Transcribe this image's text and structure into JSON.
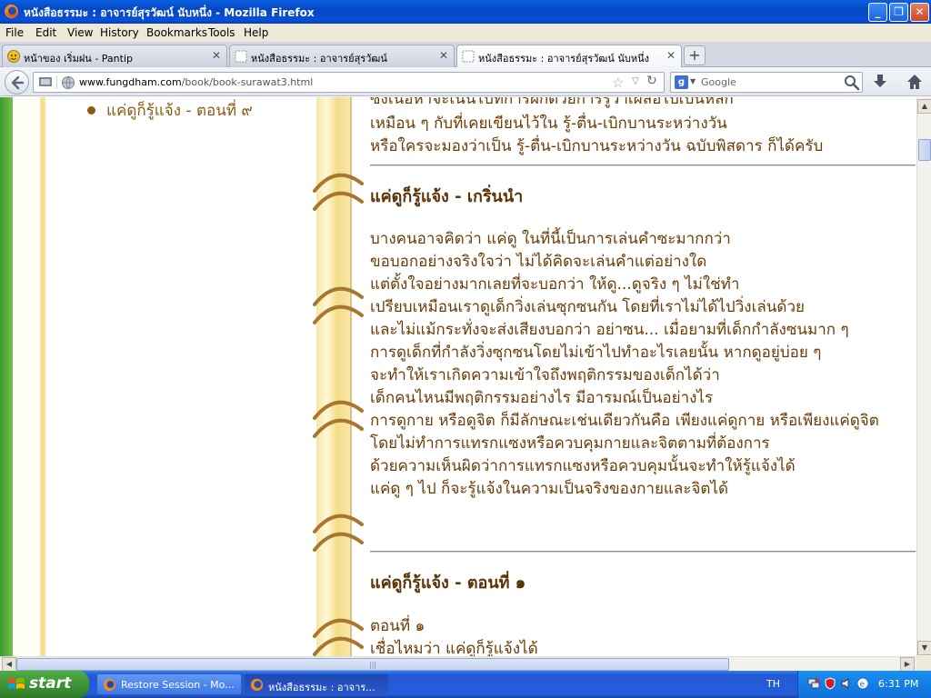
{
  "window": {
    "title": "หนังสือธรรมะ : อาจารย์สุรวัฒน์ นับหนึ่ง - Mozilla Firefox"
  },
  "menu": [
    "File",
    "Edit",
    "View",
    "History",
    "Bookmarks",
    "Tools",
    "Help"
  ],
  "tabs": [
    {
      "label": "หน้าของ เริ่มฝน - Pantip"
    },
    {
      "label": "หนังสือธรรมะ : อาจารย์สุรวัฒน์"
    },
    {
      "label": "หนังสือธรรมะ : อาจารย์สุรวัฒน์ นับหนึ่ง"
    }
  ],
  "nav": {
    "url_domain": "www.fungdham.com",
    "url_path": "/book/book-surawat3.html",
    "search_placeholder": "Google"
  },
  "page": {
    "sidebar_link": "แค่ดูก็รู้แจ้ง - ตอนที่ ๙",
    "top_lines": [
      "ซึ่งเนื้อหาจะเน้นไปที่การฝึกด้วยการรู้ว่าเผลอไปเป็นหลัก",
      "เหมือน ๆ กับที่เคยเขียนไว้ใน รู้-ตื่น-เบิกบานระหว่างวัน",
      "หรือใครจะมองว่าเป็น รู้-ตื่น-เบิกบานระหว่างวัน ฉบับพิสดาร ก็ได้ครับ"
    ],
    "section1_heading": "แค่ดูก็รู้แจ้ง - เกริ่นนำ",
    "section1_lines": [
      "บางคนอาจคิดว่า แค่ดู ในที่นี้เป็นการเล่นคำซะมากกว่า",
      "ขอบอกอย่างจริงใจว่า ไม่ได้คิดจะเล่นคำแต่อย่างใด",
      "แต่ตั้งใจอย่างมากเลยที่จะบอกว่า ให้ดู...ดูจริง ๆ ไม่ใช่ทำ",
      "เปรียบเหมือนเราดูเด็กวิ่งเล่นซุกซนกัน โดยที่เราไม่ได้ไปวิ่งเล่นด้วย",
      "และไม่แม้กระทั่งจะส่งเสียงบอกว่า อย่าซน... เมื่อยามที่เด็กกำลังซนมาก ๆ",
      "การดูเด็กที่กำลังวิ่งซุกซนโดยไม่เข้าไปทำอะไรเลยนั้น หากดูอยู่บ่อย ๆ",
      "จะทำให้เราเกิดความเข้าใจถึงพฤติกรรมของเด็กได้ว่า",
      "เด็กคนไหนมีพฤติกรรมอย่างไร มีอารมณ์เป็นอย่างไร",
      "การดูกาย หรือดูจิต ก็มีลักษณะเช่นเดียวกันคือ เพียงแค่ดูกาย หรือเพียงแค่ดูจิต",
      "โดยไม่ทำการแทรกแซงหรือควบคุมกายและจิตตามที่ต้องการ",
      "ด้วยความเห็นผิดว่าการแทรกแซงหรือควบคุมนั้นจะทำให้รู้แจ้งได้",
      "แค่ดู ๆ ไป ก็จะรู้แจ้งในความเป็นจริงของกายและจิตได้"
    ],
    "section2_heading": "แค่ดูก็รู้แจ้ง - ตอนที่ ๑",
    "section2_lines": [
      "ตอนที่ ๑",
      "เชื่อไหมว่า แค่ดูก็รู้แจ้งได้"
    ]
  },
  "taskbar": {
    "start_label": "start",
    "items": [
      {
        "label": "Restore Session - Mo..."
      },
      {
        "label": "หนังสือธรรมะ : อาจาร..."
      }
    ],
    "language": "TH",
    "clock": "6:31 PM"
  },
  "colors": {
    "text_brown": "#6b3c06",
    "heading_brown": "#5a3306",
    "xp_blue": "#245edb",
    "start_green": "#3c8f32"
  }
}
